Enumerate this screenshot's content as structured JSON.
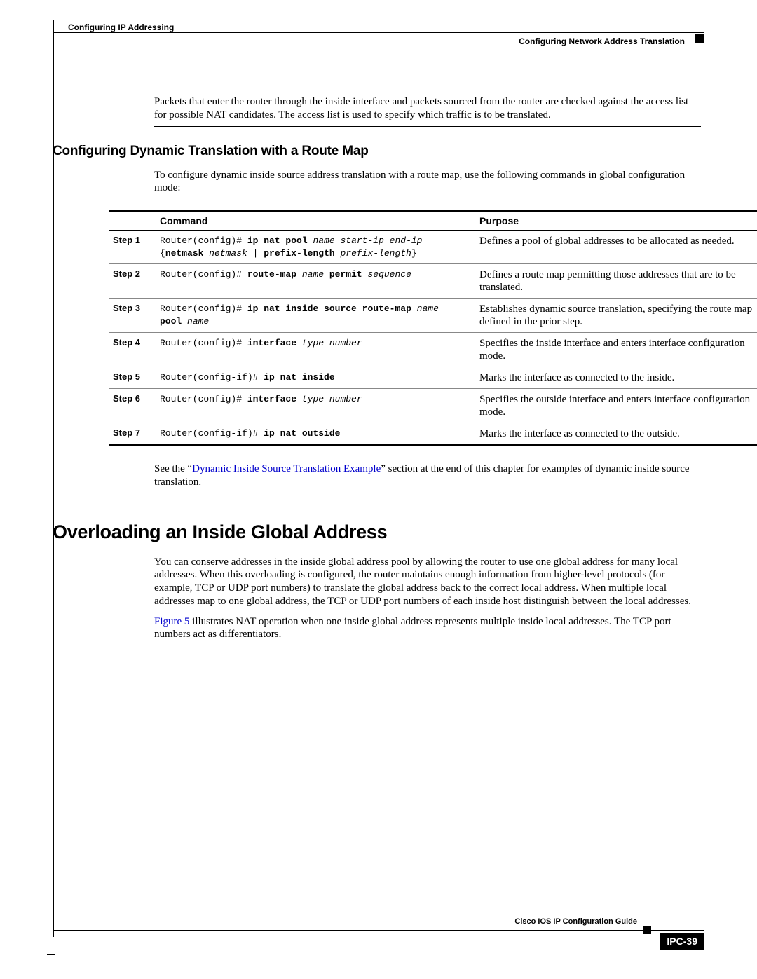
{
  "header": {
    "chapter": "Configuring IP Addressing",
    "section": "Configuring Network Address Translation"
  },
  "intro_paragraph": "Packets that enter the router through the inside interface and packets sourced from the router are checked against the access list for possible NAT candidates. The access list is used to specify which traffic is to be translated.",
  "subsection_title": "Configuring Dynamic Translation with a Route Map",
  "subsection_intro": "To configure dynamic inside source address translation with a route map, use the following commands in global configuration mode:",
  "table": {
    "headers": {
      "command": "Command",
      "purpose": "Purpose"
    },
    "rows": [
      {
        "step": "Step 1",
        "cmd_prefix": "Router(config)# ",
        "cmd_bold1": "ip nat pool",
        "cmd_italic1": " name start-ip end-ip",
        "cmd_line2_open": "{",
        "cmd_bold2": "netmask",
        "cmd_italic2": " netmask",
        "cmd_sep": " | ",
        "cmd_bold3": "prefix-length",
        "cmd_italic3": " prefix-length",
        "cmd_line2_close": "}",
        "purpose": "Defines a pool of global addresses to be allocated as needed."
      },
      {
        "step": "Step 2",
        "cmd_prefix": "Router(config)# ",
        "cmd_bold1": "route-map",
        "cmd_italic1": " name",
        "cmd_bold2": " permit",
        "cmd_italic2": " sequence",
        "purpose": "Defines a route map permitting those addresses that are to be translated."
      },
      {
        "step": "Step 3",
        "cmd_prefix": "Router(config)# ",
        "cmd_bold1": "ip nat inside source route-map",
        "cmd_italic1": " name",
        "cmd_line2_bold": "pool",
        "cmd_line2_italic": " name",
        "purpose": "Establishes dynamic source translation, specifying the route map defined in the prior step."
      },
      {
        "step": "Step 4",
        "cmd_prefix": "Router(config)# ",
        "cmd_bold1": "interface",
        "cmd_italic1": " type number",
        "purpose": "Specifies the inside interface and enters interface configuration mode."
      },
      {
        "step": "Step 5",
        "cmd_prefix": "Router(config-if)# ",
        "cmd_bold1": "ip nat inside",
        "purpose": "Marks the interface as connected to the inside."
      },
      {
        "step": "Step 6",
        "cmd_prefix": "Router(config)# ",
        "cmd_bold1": "interface",
        "cmd_italic1": " type number",
        "purpose": "Specifies the outside interface and enters interface configuration mode."
      },
      {
        "step": "Step 7",
        "cmd_prefix": "Router(config-if)# ",
        "cmd_bold1": "ip nat outside",
        "purpose": "Marks the interface as connected to the outside."
      }
    ]
  },
  "after_table_pre": "See the “",
  "after_table_link": "Dynamic Inside Source Translation Example",
  "after_table_post": "” section at the end of this chapter for examples of dynamic inside source translation.",
  "section2_title": "Overloading an Inside Global Address",
  "section2_p1": "You can conserve addresses in the inside global address pool by allowing the router to use one global address for many local addresses. When this overloading is configured, the router maintains enough information from higher-level protocols (for example, TCP or UDP port numbers) to translate the global address back to the correct local address. When multiple local addresses map to one global address, the TCP or UDP port numbers of each inside host distinguish between the local addresses.",
  "section2_p2_link": "Figure 5",
  "section2_p2_rest": " illustrates NAT operation when one inside global address represents multiple inside local addresses. The TCP port numbers act as differentiators.",
  "footer": {
    "guide": "Cisco IOS IP Configuration Guide",
    "page": "IPC-39"
  }
}
